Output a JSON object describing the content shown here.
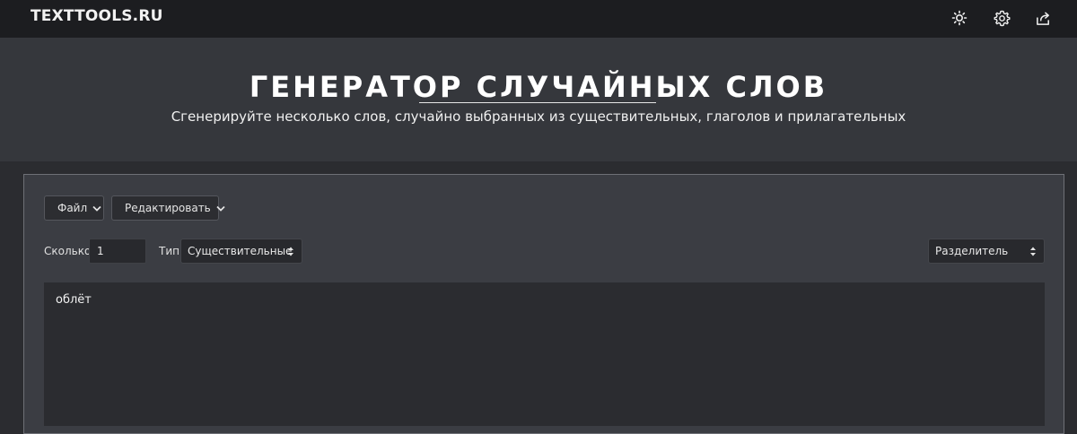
{
  "header": {
    "brand": "TEXTTOOLS.RU",
    "icons": [
      "sun-icon",
      "gear-icon",
      "share-icon"
    ]
  },
  "hero": {
    "title": "ГЕНЕРАТОР СЛУЧАЙНЫХ СЛОВ",
    "subtitle": "Сгенерируйте несколько слов, случайно выбранных из существительных, глаголов и прилагательных"
  },
  "toolbar": {
    "file_label": "Файл",
    "edit_label": "Редактировать"
  },
  "controls": {
    "count_label": "Сколько",
    "count_value": "1",
    "type_label": "Тип",
    "type_selected": "Существительные",
    "separator_selected": "Разделитель"
  },
  "output": {
    "text": "облёт"
  },
  "colors": {
    "topbar": "#1c1d20",
    "hero": "#35373c",
    "panel": "#3b3d43",
    "field": "#28292d"
  }
}
